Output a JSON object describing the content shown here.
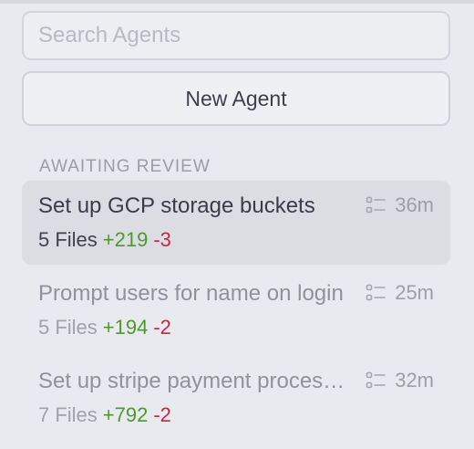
{
  "search": {
    "placeholder": "Search Agents",
    "value": ""
  },
  "new_agent_label": "New Agent",
  "section_title": "AWAITING REVIEW",
  "agents": [
    {
      "title": "Set up GCP storage buckets",
      "time": "36m",
      "files": "5 Files",
      "added": "+219",
      "removed": "-3",
      "selected": true
    },
    {
      "title": "Prompt users for name on login",
      "time": "25m",
      "files": "5 Files",
      "added": "+194",
      "removed": "-2",
      "selected": false
    },
    {
      "title": "Set up stripe payment processing",
      "time": "32m",
      "files": "7 Files",
      "added": "+792",
      "removed": "-2",
      "selected": false
    }
  ],
  "colors": {
    "added": "#4c9a2a",
    "removed": "#c2293d",
    "selected_bg": "#dcdde2",
    "panel_bg": "#e9eaef"
  },
  "icons": {
    "agent_row_icon": "list-icon"
  }
}
